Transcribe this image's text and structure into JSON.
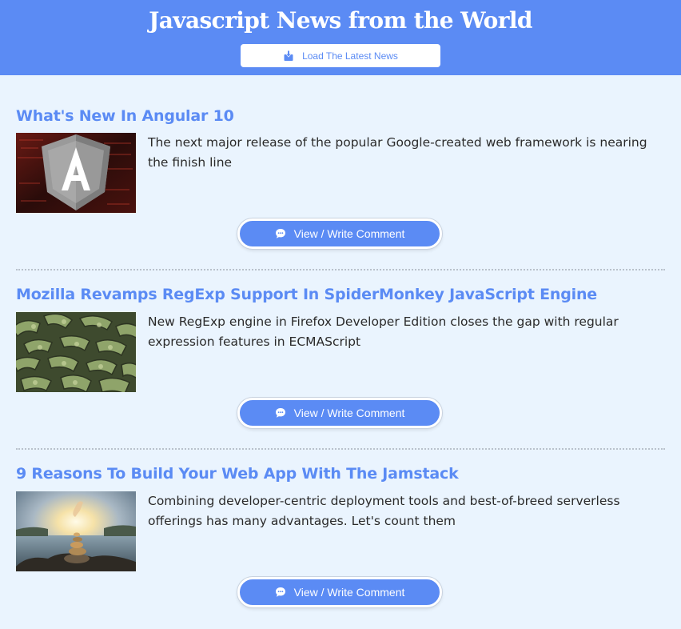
{
  "header": {
    "title": "Javascript News from the World",
    "load_button_label": "Load The Latest News",
    "load_icon": "download-icon",
    "background_color": "#5b8bf4"
  },
  "articles": [
    {
      "title": "What's New In Angular 10",
      "description": "The next major release of the popular Google-created web framework is nearing the finish line",
      "thumbnail": "angular-logo-image",
      "comment_button_label": "View / Write Comment",
      "comment_icon": "comment-icon"
    },
    {
      "title": "Mozilla Revamps RegExp Support In SpiderMonkey JavaScript Engine",
      "description": "New RegExp engine in Firefox Developer Edition closes the gap with regular expression features in ECMAScript",
      "thumbnail": "letters-pile-image",
      "comment_button_label": "View / Write Comment",
      "comment_icon": "comment-icon"
    },
    {
      "title": "9 Reasons To Build Your Web App With The Jamstack",
      "description": "Combining developer-centric deployment tools and best-of-breed serverless offerings has many advantages. Let's count them",
      "thumbnail": "stacked-stones-image",
      "comment_button_label": "View / Write Comment",
      "comment_icon": "comment-icon"
    }
  ],
  "colors": {
    "accent": "#5b8bf4",
    "page_background": "#eaf4fe",
    "divider": "#b9c1cc"
  }
}
